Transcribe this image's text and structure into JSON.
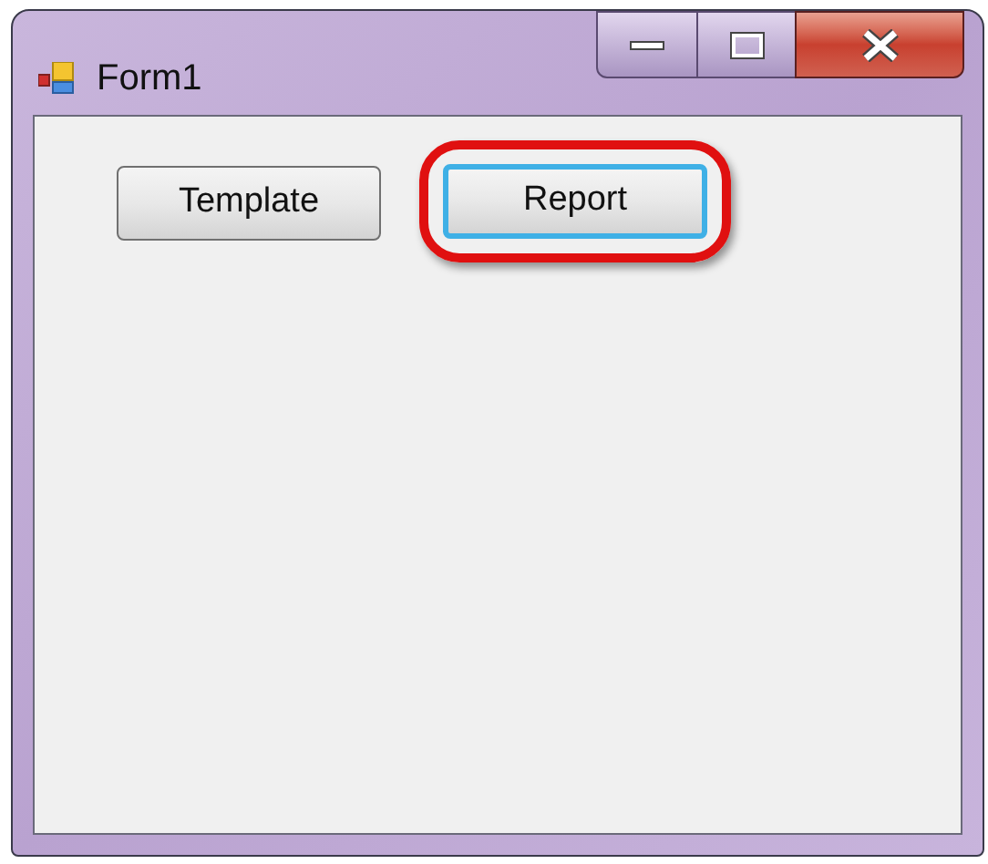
{
  "window": {
    "title": "Form1"
  },
  "buttons": [
    {
      "label": "Template",
      "focused": false,
      "highlighted": false
    },
    {
      "label": "Report",
      "focused": true,
      "highlighted": true
    }
  ]
}
